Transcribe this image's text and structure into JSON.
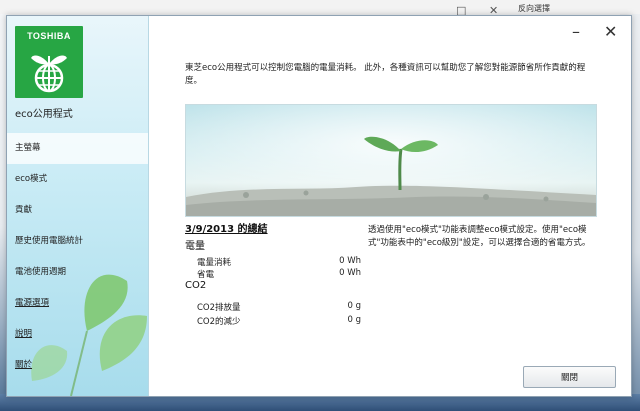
{
  "background": {
    "window_controls": [
      "□",
      "✕"
    ],
    "right_text": "反向選擇"
  },
  "brand": {
    "logo_text": "TOSHIBA",
    "logo_color": "#27a644",
    "app_name": "eco公用程式"
  },
  "window_controls": {
    "minimize": "–",
    "close": "✕"
  },
  "nav": {
    "items": [
      {
        "label": "主螢幕"
      },
      {
        "label": "eco模式"
      },
      {
        "label": "貢獻"
      },
      {
        "label": "歷史使用電腦統計"
      },
      {
        "label": "電池使用週期"
      },
      {
        "label": "電源選項"
      },
      {
        "label": "說明"
      },
      {
        "label": "關於"
      }
    ]
  },
  "intro": "東芝eco公用程式可以控制您電腦的電量消耗。 此外，各種資訊可以幫助您了解您對能源節省所作貢獻的程度。",
  "summary": {
    "title": "3/9/2013 的總結",
    "power": {
      "heading": "電量",
      "rows": [
        {
          "label": "電量消耗",
          "value": "0 Wh"
        },
        {
          "label": "省電",
          "value": "0 Wh"
        }
      ]
    },
    "co2": {
      "heading": "CO2",
      "rows": [
        {
          "label": "CO2排放量",
          "value": "0 g"
        },
        {
          "label": "CO2的減少",
          "value": "0 g"
        }
      ]
    }
  },
  "tip": "透過使用\"eco模式\"功能表調整eco模式設定。使用\"eco模式\"功能表中的\"eco級別\"設定，可以選擇合適的省電方式。",
  "buttons": {
    "close_label": "關閉"
  }
}
